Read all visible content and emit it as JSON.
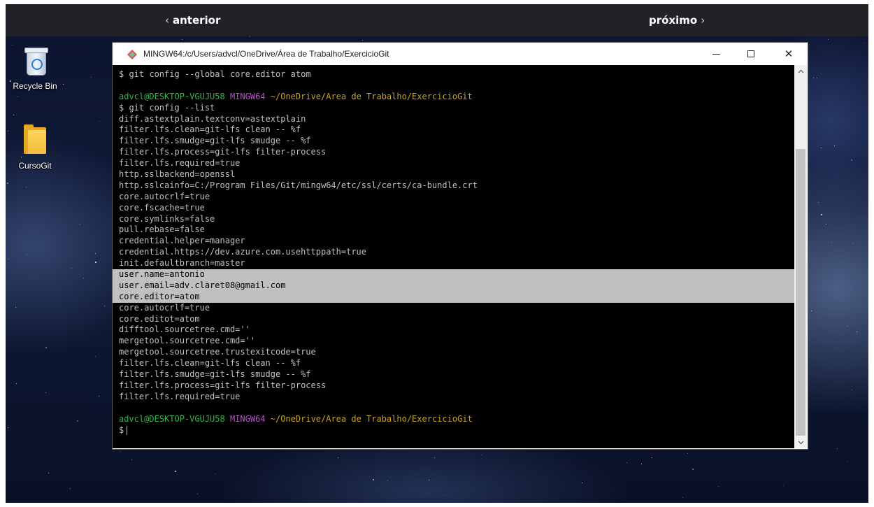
{
  "navigation": {
    "prev_label": "anterior",
    "prev_chevron": "‹",
    "next_label": "próximo",
    "next_chevron": "›"
  },
  "desktop": {
    "icons": [
      {
        "label": "Recycle Bin",
        "icon": "recycle-bin-icon"
      },
      {
        "label": "CursoGit",
        "icon": "folder-icon"
      }
    ]
  },
  "window": {
    "title": "MINGW64:/c/Users/advcl/OneDrive/Área de Trabalho/ExercicioGit",
    "icon": "git-bash-icon",
    "controls": {
      "minimize": "minimize-icon",
      "maximize": "maximize-icon",
      "close_glyph": "✕"
    }
  },
  "terminal": {
    "first_line": "$ git config --global core.editor atom",
    "prompt": {
      "user_host": "advcl@DESKTOP-VGUJU58",
      "system": "MINGW64",
      "path": "~/OneDrive/Area de Trabalho/ExercicioGit"
    },
    "command": "$ git config --list",
    "output_lines": [
      "diff.astextplain.textconv=astextplain",
      "filter.lfs.clean=git-lfs clean -- %f",
      "filter.lfs.smudge=git-lfs smudge -- %f",
      "filter.lfs.process=git-lfs filter-process",
      "filter.lfs.required=true",
      "http.sslbackend=openssl",
      "http.sslcainfo=C:/Program Files/Git/mingw64/etc/ssl/certs/ca-bundle.crt",
      "core.autocrlf=true",
      "core.fscache=true",
      "core.symlinks=false",
      "pull.rebase=false",
      "credential.helper=manager",
      "credential.https://dev.azure.com.usehttppath=true",
      "init.defaultbranch=master"
    ],
    "highlighted_lines": [
      "user.name=antonio",
      "user.email=adv.claret08@gmail.com",
      "core.editor=atom"
    ],
    "output_lines_after": [
      "core.autocrlf=true",
      "core.editot=atom",
      "difftool.sourcetree.cmd=''",
      "mergetool.sourcetree.cmd=''",
      "mergetool.sourcetree.trustexitcode=true",
      "filter.lfs.clean=git-lfs clean -- %f",
      "filter.lfs.smudge=git-lfs smudge -- %f",
      "filter.lfs.process=git-lfs filter-process",
      "filter.lfs.required=true"
    ],
    "final_prompt_symbol": "$",
    "colors": {
      "user_host": "#37b24d",
      "system": "#b257c2",
      "path": "#c9a227",
      "highlight": "#c0c0c0"
    }
  }
}
